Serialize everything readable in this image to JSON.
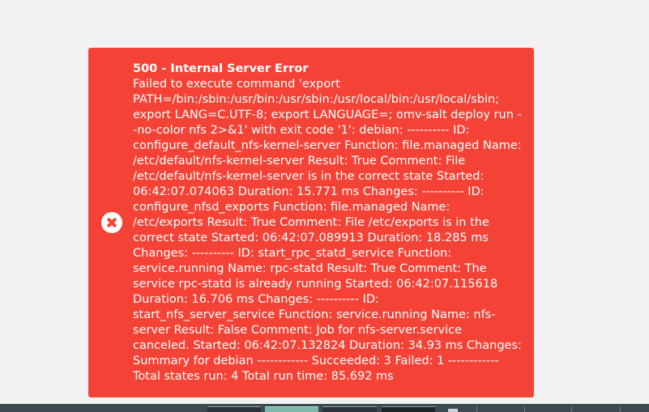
{
  "error": {
    "title": "500 - Internal Server Error",
    "message": "Failed to execute command 'export PATH=/bin:/sbin:/usr/bin:/usr/sbin:/usr/local/bin:/usr/local/sbin; export LANG=C.UTF-8; export LANGUAGE=; omv-salt deploy run --no-color nfs 2>&1' with exit code '1': debian: ---------- ID: configure_default_nfs-kernel-server Function: file.managed Name: /etc/default/nfs-kernel-server Result: True Comment: File /etc/default/nfs-kernel-server is in the correct state Started: 06:42:07.074063 Duration: 15.771 ms Changes: ---------- ID: configure_nfsd_exports Function: file.managed Name: /etc/exports Result: True Comment: File /etc/exports is in the correct state Started: 06:42:07.089913 Duration: 18.285 ms Changes: ---------- ID: start_rpc_statd_service Function: service.running Name: rpc-statd Result: True Comment: The service rpc-statd is already running Started: 06:42:07.115618 Duration: 16.706 ms Changes: ---------- ID: start_nfs_server_service Function: service.running Name: nfs-server Result: False Comment: Job for nfs-server.service canceled. Started: 06:42:07.132824 Duration: 34.93 ms Changes: Summary for debian ------------ Succeeded: 3 Failed: 1 ------------ Total states run: 4 Total run time: 85.692 ms",
    "icon": "close-circle-icon",
    "background_color": "#f44336"
  }
}
